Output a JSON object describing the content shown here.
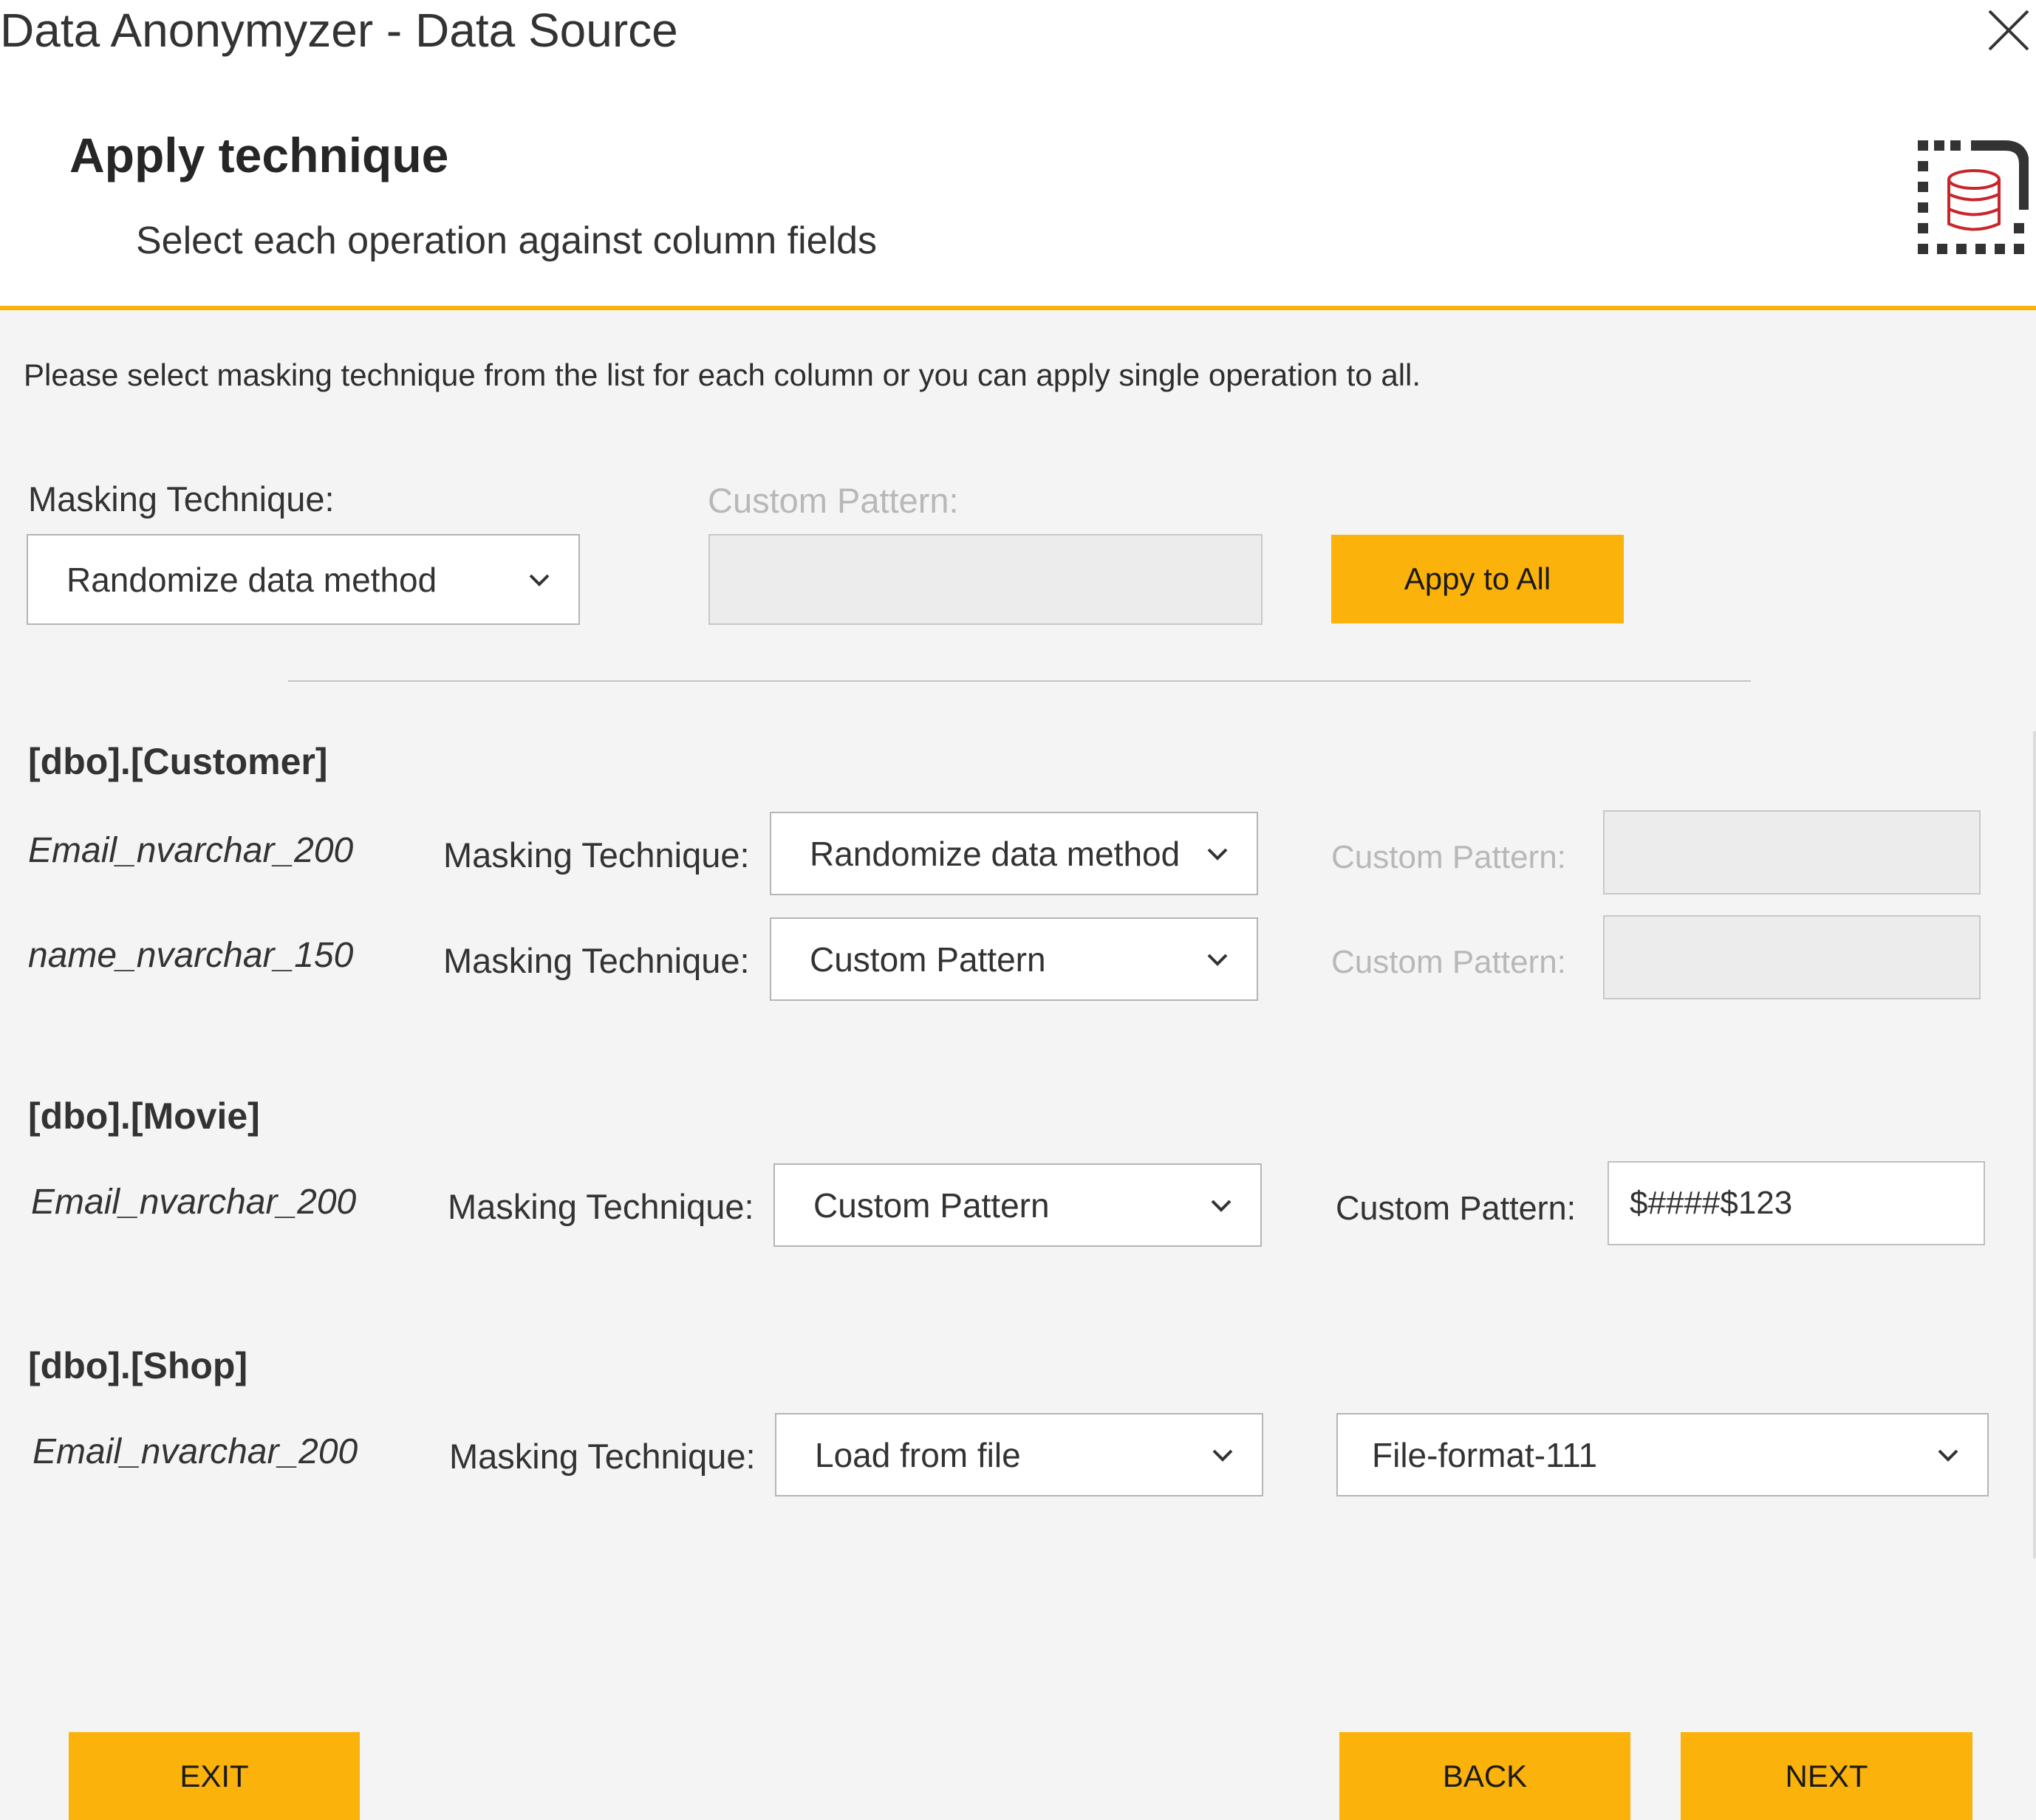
{
  "window": {
    "title": "Data Anonymyzer - Data Source"
  },
  "header": {
    "title": "Apply technique",
    "subtitle": "Select each operation against column fields"
  },
  "instructions": "Please select masking technique from the list for each column or you can apply single operation to all.",
  "global": {
    "technique_label": "Masking Technique:",
    "technique_value": "Randomize data method",
    "pattern_label": "Custom Pattern:",
    "pattern_value": "",
    "apply_label": "Appy to All"
  },
  "tables": [
    {
      "name": "[dbo].[Customer]",
      "rows": [
        {
          "column": "Email_nvarchar_200",
          "technique_label": "Masking Technique:",
          "technique": "Randomize data method",
          "pattern_label": "Custom Pattern:",
          "pattern": ""
        },
        {
          "column": "name_nvarchar_150",
          "technique_label": "Masking Technique:",
          "technique": "Custom Pattern",
          "pattern_label": "Custom Pattern:",
          "pattern": ""
        }
      ]
    },
    {
      "name": "[dbo].[Movie]",
      "rows": [
        {
          "column": "Email_nvarchar_200",
          "technique_label": "Masking Technique:",
          "technique": "Custom Pattern",
          "pattern_label": "Custom Pattern:",
          "pattern": "$####$123"
        }
      ]
    },
    {
      "name": "[dbo].[Shop]",
      "rows": [
        {
          "column": "Email_nvarchar_200",
          "technique_label": "Masking Technique:",
          "technique": "Load from file",
          "file": "File-format-111"
        }
      ]
    }
  ],
  "footer": {
    "exit_label": "EXIT",
    "back_label": "BACK",
    "next_label": "NEXT"
  },
  "colors": {
    "accent": "#fbb20a",
    "background": "#f4f4f4",
    "logo_red": "#c8262b"
  },
  "icons": {
    "close": "close-icon",
    "logo": "database-dotted-frame-icon",
    "dropdown": "chevron-down-icon"
  }
}
